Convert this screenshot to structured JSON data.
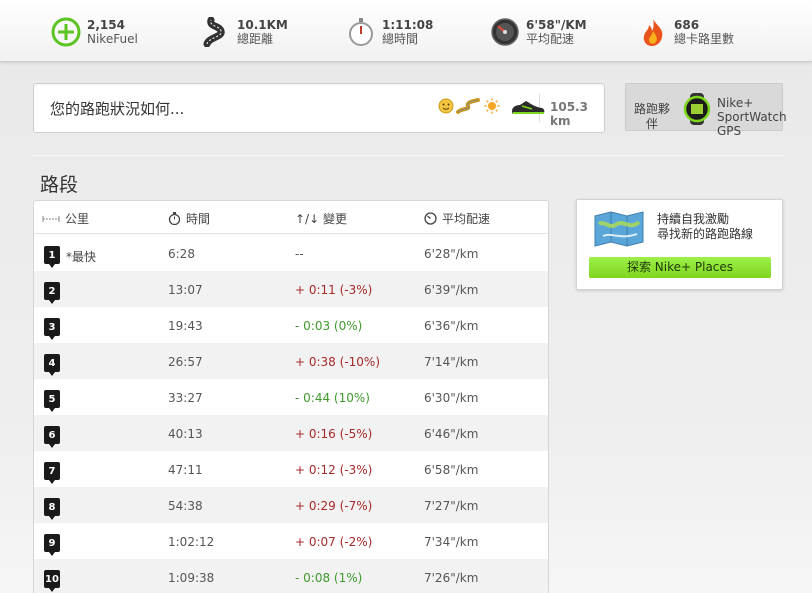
{
  "stats": [
    {
      "value": "2,154",
      "label": "NikeFuel",
      "icon": "nikefuel-icon"
    },
    {
      "value": "10.1KM",
      "label": "總距離",
      "icon": "road-icon"
    },
    {
      "value": "1:11:08",
      "label": "總時間",
      "icon": "stopwatch-icon"
    },
    {
      "value": "6'58\"/KM",
      "label": "平均配速",
      "icon": "speedometer-icon"
    },
    {
      "value": "686",
      "label": "總卡路里數",
      "icon": "flame-icon"
    }
  ],
  "status": {
    "placeholder": "您的路跑狀況如何...",
    "distance": "105.3 km",
    "icons": [
      "smiley-icon",
      "terrain-icon",
      "sun-icon",
      "shoe-icon"
    ]
  },
  "companion": {
    "label": "路跑夥伴",
    "device": "Nike+ SportWatch GPS"
  },
  "section_title": "路段",
  "table": {
    "headers": {
      "km": "公里",
      "time": "時間",
      "change": "↑/↓ 變更",
      "pace": "平均配速"
    },
    "rows": [
      {
        "n": "1",
        "best": "*最快",
        "time": "6:28",
        "change": "--",
        "trend": "none",
        "pace": "6'28\"/km"
      },
      {
        "n": "2",
        "best": "",
        "time": "13:07",
        "change": "+ 0:11 (-3%)",
        "trend": "up",
        "pace": "6'39\"/km"
      },
      {
        "n": "3",
        "best": "",
        "time": "19:43",
        "change": "- 0:03 (0%)",
        "trend": "down",
        "pace": "6'36\"/km"
      },
      {
        "n": "4",
        "best": "",
        "time": "26:57",
        "change": "+ 0:38 (-10%)",
        "trend": "up",
        "pace": "7'14\"/km"
      },
      {
        "n": "5",
        "best": "",
        "time": "33:27",
        "change": "- 0:44 (10%)",
        "trend": "down",
        "pace": "6'30\"/km"
      },
      {
        "n": "6",
        "best": "",
        "time": "40:13",
        "change": "+ 0:16 (-5%)",
        "trend": "up",
        "pace": "6'46\"/km"
      },
      {
        "n": "7",
        "best": "",
        "time": "47:11",
        "change": "+ 0:12 (-3%)",
        "trend": "up",
        "pace": "6'58\"/km"
      },
      {
        "n": "8",
        "best": "",
        "time": "54:38",
        "change": "+ 0:29 (-7%)",
        "trend": "up",
        "pace": "7'27\"/km"
      },
      {
        "n": "9",
        "best": "",
        "time": "1:02:12",
        "change": "+ 0:07 (-2%)",
        "trend": "up",
        "pace": "7'34\"/km"
      },
      {
        "n": "10",
        "best": "",
        "time": "1:09:38",
        "change": "- 0:08 (1%)",
        "trend": "down",
        "pace": "7'26\"/km"
      }
    ]
  },
  "places": {
    "line1": "持續自我激勵",
    "line2": "尋找新的路跑路線",
    "button": "探索 Nike+ Places"
  },
  "colors": {
    "accent_green": "#7fd61e",
    "fuel_green": "#5cc422",
    "change_up": "#a52a2a",
    "change_down": "#3f9a2c"
  }
}
